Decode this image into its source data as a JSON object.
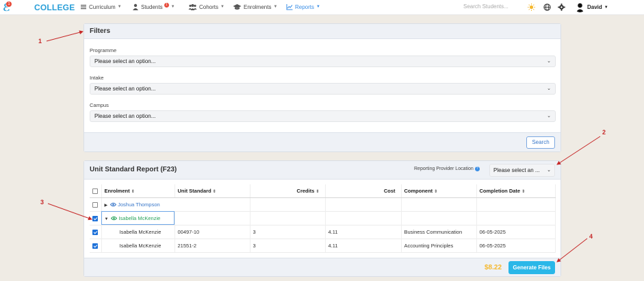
{
  "nav": {
    "logo_badge": "1",
    "brand": "COLLEGE",
    "items": [
      {
        "label": "Curriculum",
        "icon": "menu-icon"
      },
      {
        "label": "Students",
        "icon": "user-icon",
        "badge": "1"
      },
      {
        "label": "Cohorts",
        "icon": "users-icon"
      },
      {
        "label": "Enrolments",
        "icon": "graduation-cap-icon"
      },
      {
        "label": "Reports",
        "icon": "chart-line-icon",
        "active": true
      }
    ],
    "search_placeholder": "Search Students...",
    "user_name": "David"
  },
  "filters": {
    "title": "Filters",
    "fields": [
      {
        "label": "Programme",
        "value": "Please select an option..."
      },
      {
        "label": "Intake",
        "value": "Please select an option..."
      },
      {
        "label": "Campus",
        "value": "Please select an option..."
      }
    ],
    "search_button": "Search"
  },
  "report": {
    "title": "Unit Standard Report (F23)",
    "provider_label": "Reporting Provider Location",
    "provider_value": "Please select an ...",
    "columns": [
      "Enrolment",
      "Unit Standard",
      "Credits",
      "Cost",
      "Component",
      "Completion Date"
    ],
    "rows": [
      {
        "type": "group",
        "checked": false,
        "expanded": false,
        "name": "Joshua Thompson"
      },
      {
        "type": "group",
        "checked": true,
        "expanded": true,
        "name": "Isabella McKenzie"
      },
      {
        "type": "item",
        "checked": true,
        "enrolment": "Isabella McKenzie",
        "unit": "00497-10",
        "credits": "3",
        "cost": "4.11",
        "component": "Business Communication",
        "date": "06-05-2025"
      },
      {
        "type": "item",
        "checked": true,
        "enrolment": "Isabella McKenzie",
        "unit": "21551-2",
        "credits": "3",
        "cost": "4.11",
        "component": "Accounting Principles",
        "date": "06-05-2025"
      }
    ],
    "total_cost": "$8.22",
    "generate_button": "Generate Files"
  },
  "annotations": [
    "1",
    "2",
    "3",
    "4"
  ],
  "colors": {
    "accent": "#2a9fd8",
    "annotation": "#c62828",
    "total": "#f5b82e"
  }
}
